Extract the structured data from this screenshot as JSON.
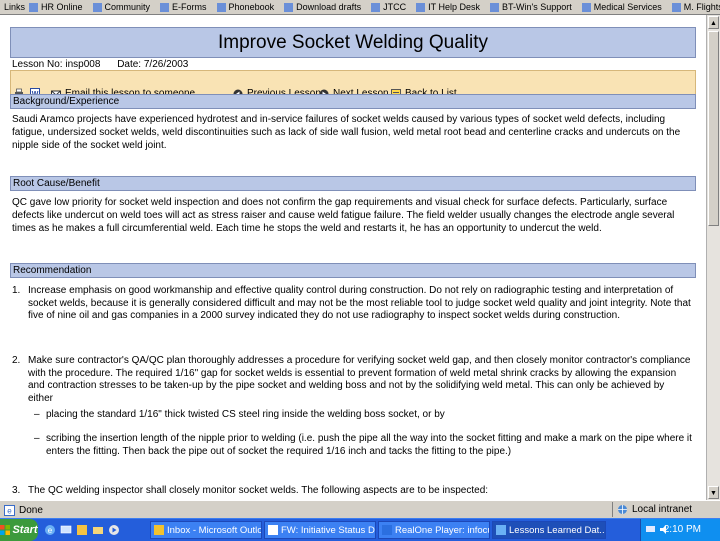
{
  "links_bar": {
    "label": "Links",
    "items": [
      "HR Online",
      "Community",
      "E-Forms",
      "Phonebook",
      "Download drafts",
      "JTCC",
      "IT Help Desk",
      "BT-Win's Support",
      "Medical Services",
      "M. Flights"
    ]
  },
  "title": "Improve Socket Welding Quality",
  "meta": {
    "lesson_no": "Lesson No:  insp008",
    "date": "Date:  7/26/2003"
  },
  "toolbar": {
    "email": "Email this lesson to someone",
    "previous": "Previous Lesson",
    "next": "Next Lesson",
    "back": "Back to List"
  },
  "background": {
    "heading": "Background/Experience",
    "text": "Saudi Aramco projects have experienced hydrotest and in-service failures of socket welds caused by various types of socket weld defects, including fatigue, undersized socket welds, weld discontinuities such as lack of side wall fusion, weld metal root bead and centerline cracks and undercuts on the nipple side of the socket weld joint."
  },
  "root_cause": {
    "heading": "Root Cause/Benefit",
    "text": "QC gave low priority for socket weld inspection and does not confirm the gap requirements and visual check for surface defects. Particularly, surface defects like undercut on weld toes will act as stress raiser and cause weld fatigue failure. The field welder usually changes the electrode angle several times as he makes a full circumferential weld. Each time he stops the weld and restarts it, he has an opportunity to undercut the weld."
  },
  "recommendation": {
    "heading": "Recommendation",
    "items": [
      {
        "num": "1.",
        "text": "Increase emphasis on good workmanship and effective quality control during construction. Do not rely on radiographic testing and interpretation of socket welds, because it is generally considered difficult and may not be the most reliable tool to judge socket weld quality and joint integrity. Note that five of nine oil and gas companies in a 2000 survey indicated they do not use radiography to inspect socket welds during construction."
      },
      {
        "num": "2.",
        "text": "Make sure contractor's QA/QC plan thoroughly addresses a procedure for verifying socket weld gap, and then closely monitor contractor's compliance with the procedure. The required 1/16\" gap for socket welds is essential to prevent formation of weld metal shrink cracks by allowing the expansion and contraction stresses to be taken-up by the pipe socket and welding boss and not by the solidifying weld metal. This can only be achieved by either"
      },
      {
        "num": "3.",
        "text": "The QC welding inspector shall closely monitor socket welds. The following aspects are to be inspected:"
      }
    ],
    "sub_items": [
      {
        "dash": "–",
        "text": "placing the standard 1/16\" thick twisted CS steel ring inside the welding boss socket, or by"
      },
      {
        "dash": "–",
        "text": "scribing the insertion length of the nipple prior to welding (i.e. push the pipe all the way into the socket fitting and make a mark on the pipe where it enters the fitting. Then back the pipe out of socket the required 1/16 inch and tacks the fitting to the pipe.)"
      }
    ]
  },
  "status_bar": {
    "text": "Done",
    "zone": "Local intranet"
  },
  "taskbar": {
    "start": "Start",
    "tasks": [
      "Inbox - Microsoft Outlook",
      "FW: Initiative Status Du...",
      "RealOne Player: infocus ...",
      "Lessons Learned Dat..."
    ],
    "clock": "2:10 PM"
  },
  "colors": {
    "title_bg": "#b9c7e6",
    "toolbar_bg": "#f9e3b4",
    "taskbar": "#245edb"
  }
}
